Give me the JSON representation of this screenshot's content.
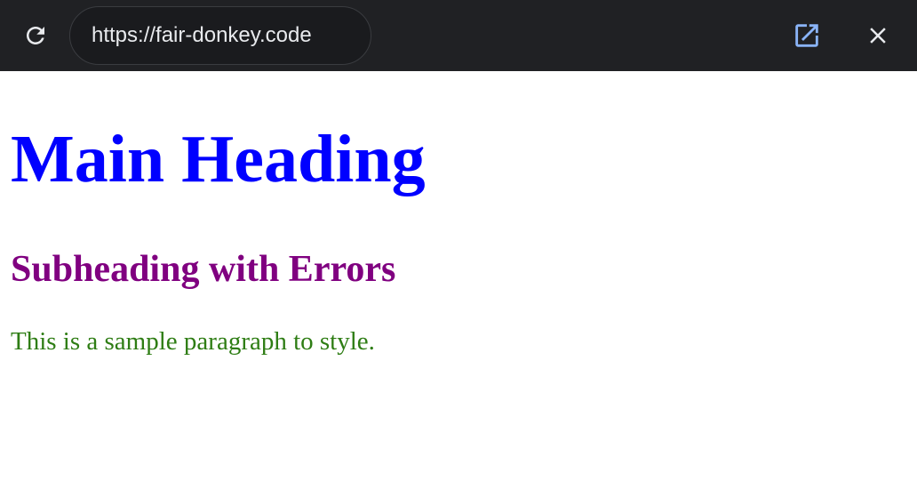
{
  "browser": {
    "url": "https://fair-donkey.code",
    "reload_icon": "reload-icon",
    "open_external_icon": "open-in-new-icon",
    "close_icon": "close-icon",
    "accent_color": "#8ab4f8",
    "icon_color": "#e8eaed",
    "bar_color": "#202124"
  },
  "page": {
    "main_heading": "Main Heading",
    "subheading": "Subheading with Errors",
    "paragraph": "This is a sample paragraph to style.",
    "colors": {
      "main_heading": "#0000ff",
      "subheading": "#800080",
      "paragraph": "#2e7d14"
    }
  }
}
